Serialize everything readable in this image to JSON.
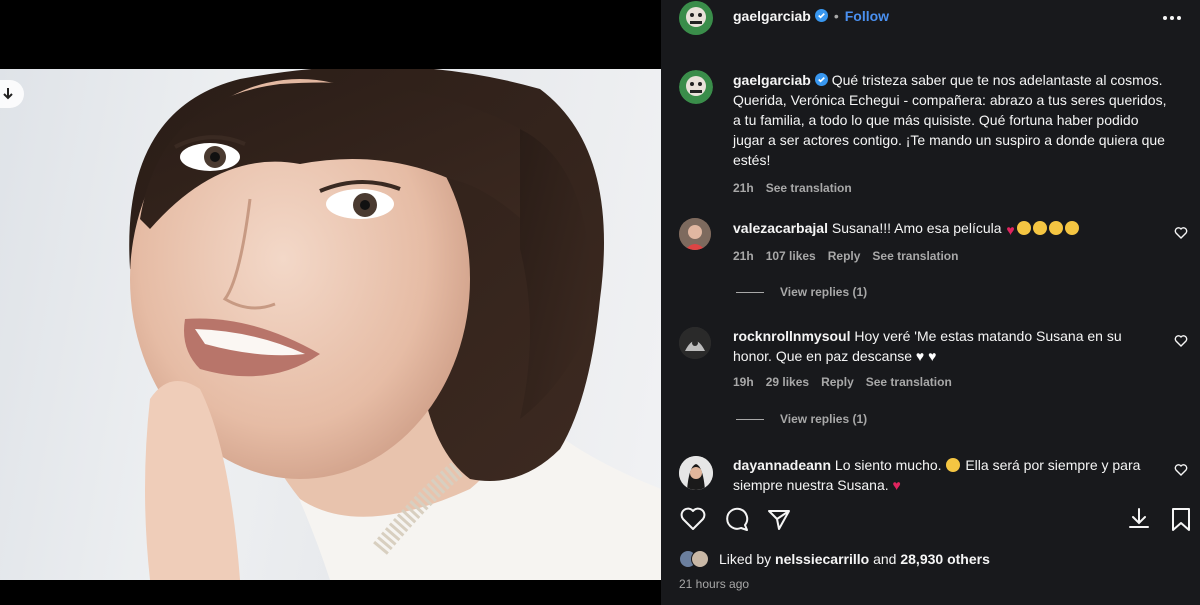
{
  "post": {
    "author": "gaelgarciab",
    "follow_label": "Follow",
    "dot": "•",
    "caption_text": "Qué tristeza saber que te nos adelantaste al cosmos. Querida, Verónica Echegui - compañera: abrazo a tus seres queridos, a tu familia, a todo lo que más quisiste. Qué fortuna haber podido jugar a ser actores contigo. ¡Te mando un suspiro a donde quiera que estés!",
    "caption_time": "21h",
    "see_translation": "See translation"
  },
  "comments": [
    {
      "username": "valezacarbajal",
      "text": "Susana!!! Amo esa película",
      "time": "21h",
      "likes": "107 likes",
      "reply": "Reply",
      "see_translation": "See translation",
      "view_replies": "View replies (1)"
    },
    {
      "username": "rocknrollnmysoul",
      "text": "Hoy veré 'Me estas matando Susana en su honor. Que en paz descanse",
      "time": "19h",
      "likes": "29 likes",
      "reply": "Reply",
      "see_translation": "See translation",
      "view_replies": "View replies (1)"
    },
    {
      "username": "dayannadeann",
      "text_a": "Lo siento mucho.",
      "text_b": "Ella será por siempre y para siempre nuestra Susana."
    }
  ],
  "footer": {
    "liked_by_prefix": "Liked by ",
    "liked_by_user": "nelssiecarrillo",
    "liked_by_mid": " and ",
    "liked_by_count": "28,930 others",
    "time_ago": "21 hours ago"
  },
  "icons": {
    "verified": "verified-badge-icon",
    "more": "more-options-icon",
    "heart": "heart-icon",
    "comment": "comment-icon",
    "share": "share-icon",
    "download": "download-icon",
    "bookmark": "bookmark-icon"
  },
  "colors": {
    "panel_bg": "#18191c",
    "link_blue": "#4a90f0",
    "muted": "#a8a8a8",
    "red_heart": "#e0245e"
  }
}
